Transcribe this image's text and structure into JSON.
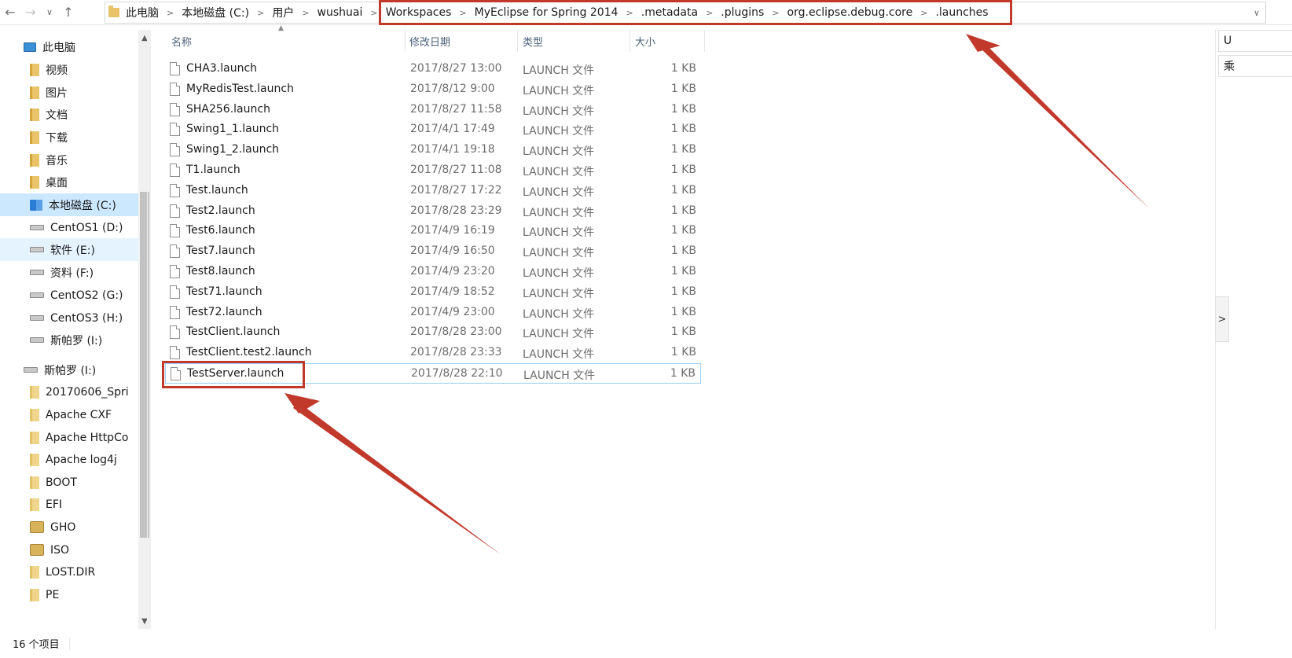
{
  "nav": {
    "back_icon": "back-arrow-icon",
    "forward_icon": "forward-arrow-icon",
    "recent_icon": "chevron-down-icon",
    "up_icon": "up-arrow-icon",
    "back": "←",
    "forward": "→",
    "recent": "∨",
    "up": "↑"
  },
  "breadcrumb": [
    "此电脑",
    "本地磁盘 (C:)",
    "用户",
    "wushuai",
    "Workspaces",
    "MyEclipse for Spring 2014",
    ".metadata",
    ".plugins",
    "org.eclipse.debug.core",
    ".launches"
  ],
  "breadcrumb_separator": ">",
  "address_dropdown": "∨",
  "sidebar": {
    "items": [
      {
        "label": "此电脑",
        "icon": "pc-icon",
        "indent": 0,
        "state": "normal"
      },
      {
        "label": "视频",
        "icon": "video-folder-icon",
        "indent": 1,
        "state": "normal"
      },
      {
        "label": "图片",
        "icon": "pictures-folder-icon",
        "indent": 1,
        "state": "normal"
      },
      {
        "label": "文档",
        "icon": "documents-folder-icon",
        "indent": 1,
        "state": "normal"
      },
      {
        "label": "下载",
        "icon": "downloads-folder-icon",
        "indent": 1,
        "state": "normal"
      },
      {
        "label": "音乐",
        "icon": "music-folder-icon",
        "indent": 1,
        "state": "normal"
      },
      {
        "label": "桌面",
        "icon": "desktop-folder-icon",
        "indent": 1,
        "state": "normal"
      },
      {
        "label": "本地磁盘 (C:)",
        "icon": "system-drive-icon",
        "indent": 1,
        "state": "selected"
      },
      {
        "label": "CentOS1 (D:)",
        "icon": "drive-icon",
        "indent": 1,
        "state": "normal"
      },
      {
        "label": "软件 (E:)",
        "icon": "drive-icon",
        "indent": 1,
        "state": "hover"
      },
      {
        "label": "资料 (F:)",
        "icon": "drive-icon",
        "indent": 1,
        "state": "normal"
      },
      {
        "label": "CentOS2 (G:)",
        "icon": "drive-icon",
        "indent": 1,
        "state": "normal"
      },
      {
        "label": "CentOS3 (H:)",
        "icon": "drive-icon",
        "indent": 1,
        "state": "normal"
      },
      {
        "label": "斯帕罗 (I:)",
        "icon": "drive-icon",
        "indent": 1,
        "state": "normal"
      },
      {
        "label": "斯帕罗 (I:)",
        "icon": "drive-icon",
        "indent": 0,
        "state": "normal"
      },
      {
        "label": "20170606_Spri",
        "icon": "folder-icon",
        "indent": 1,
        "state": "normal"
      },
      {
        "label": "Apache CXF",
        "icon": "folder-icon",
        "indent": 1,
        "state": "normal"
      },
      {
        "label": "Apache HttpCo",
        "icon": "folder-icon",
        "indent": 1,
        "state": "normal"
      },
      {
        "label": "Apache log4j",
        "icon": "folder-icon",
        "indent": 1,
        "state": "normal"
      },
      {
        "label": "BOOT",
        "icon": "folder-icon",
        "indent": 1,
        "state": "normal"
      },
      {
        "label": "EFI",
        "icon": "folder-icon",
        "indent": 1,
        "state": "normal"
      },
      {
        "label": "GHO",
        "icon": "gho-folder-icon",
        "indent": 1,
        "state": "normal"
      },
      {
        "label": "ISO",
        "icon": "gho-folder-icon",
        "indent": 1,
        "state": "normal"
      },
      {
        "label": "LOST.DIR",
        "icon": "folder-icon",
        "indent": 1,
        "state": "normal"
      },
      {
        "label": "PE",
        "icon": "folder-icon",
        "indent": 1,
        "state": "normal"
      }
    ]
  },
  "columns": {
    "name": "名称",
    "date": "修改日期",
    "type": "类型",
    "size": "大小"
  },
  "files": [
    {
      "name": "CHA3.launch",
      "date": "2017/8/27 13:00",
      "type": "LAUNCH 文件",
      "size": "1 KB"
    },
    {
      "name": "MyRedisTest.launch",
      "date": "2017/8/12 9:00",
      "type": "LAUNCH 文件",
      "size": "1 KB"
    },
    {
      "name": "SHA256.launch",
      "date": "2017/8/27 11:58",
      "type": "LAUNCH 文件",
      "size": "1 KB"
    },
    {
      "name": "Swing1_1.launch",
      "date": "2017/4/1 17:49",
      "type": "LAUNCH 文件",
      "size": "1 KB"
    },
    {
      "name": "Swing1_2.launch",
      "date": "2017/4/1 19:18",
      "type": "LAUNCH 文件",
      "size": "1 KB"
    },
    {
      "name": "T1.launch",
      "date": "2017/8/27 11:08",
      "type": "LAUNCH 文件",
      "size": "1 KB"
    },
    {
      "name": "Test.launch",
      "date": "2017/8/27 17:22",
      "type": "LAUNCH 文件",
      "size": "1 KB"
    },
    {
      "name": "Test2.launch",
      "date": "2017/8/28 23:29",
      "type": "LAUNCH 文件",
      "size": "1 KB"
    },
    {
      "name": "Test6.launch",
      "date": "2017/4/9 16:19",
      "type": "LAUNCH 文件",
      "size": "1 KB"
    },
    {
      "name": "Test7.launch",
      "date": "2017/4/9 16:50",
      "type": "LAUNCH 文件",
      "size": "1 KB"
    },
    {
      "name": "Test8.launch",
      "date": "2017/4/9 23:20",
      "type": "LAUNCH 文件",
      "size": "1 KB"
    },
    {
      "name": "Test71.launch",
      "date": "2017/4/9 18:52",
      "type": "LAUNCH 文件",
      "size": "1 KB"
    },
    {
      "name": "Test72.launch",
      "date": "2017/4/9 23:00",
      "type": "LAUNCH 文件",
      "size": "1 KB"
    },
    {
      "name": "TestClient.launch",
      "date": "2017/8/28 23:00",
      "type": "LAUNCH 文件",
      "size": "1 KB"
    },
    {
      "name": "TestClient.test2.launch",
      "date": "2017/8/28 23:33",
      "type": "LAUNCH 文件",
      "size": "1 KB"
    },
    {
      "name": "TestServer.launch",
      "date": "2017/8/28 22:10",
      "type": "LAUNCH 文件",
      "size": "1 KB",
      "selected": true
    }
  ],
  "right_panel": {
    "tab1": "U",
    "tab2": "乘",
    "expander": ">"
  },
  "status": {
    "item_count": "16 个项目"
  },
  "colors": {
    "annotation": "#c0392b",
    "selected_bg": "#cce8ff",
    "hover_bg": "#e5f3ff",
    "selection_border": "#99d1ff",
    "header_text": "#4c607a"
  }
}
